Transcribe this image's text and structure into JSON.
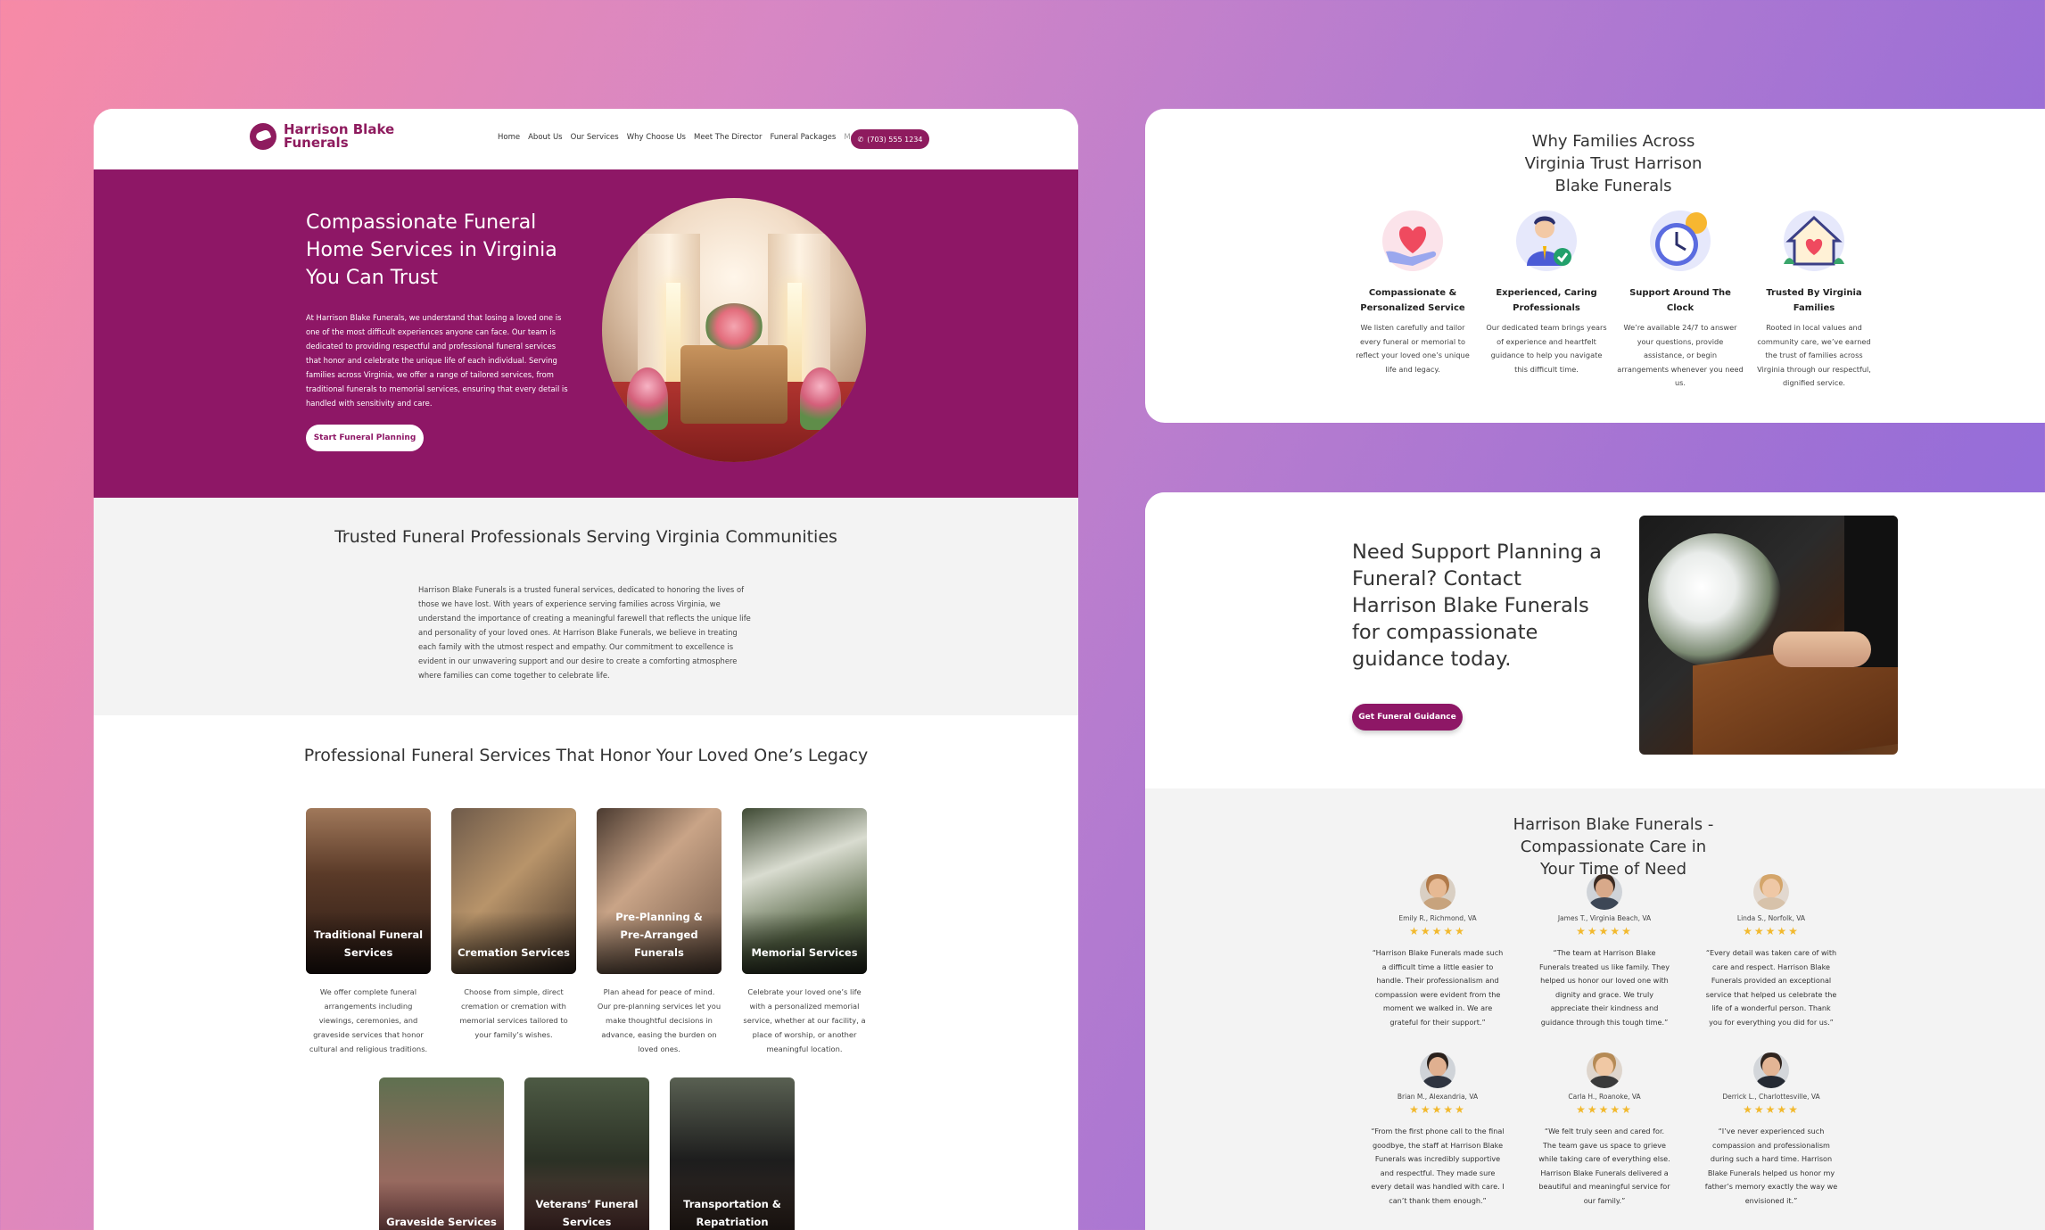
{
  "brand": {
    "name_line1": "Harrison Blake",
    "name_line2": "Funerals",
    "color": "#8e1766"
  },
  "nav": {
    "items": [
      "Home",
      "About Us",
      "Our Services",
      "Why Choose Us",
      "Meet The Director",
      "Funeral Packages"
    ],
    "more": "More",
    "phone": "(703) 555 1234"
  },
  "hero": {
    "title": "Compassionate Funeral Home Services in Virginia You Can Trust",
    "body": "At Harrison Blake Funerals, we understand that losing a loved one is one of the most difficult experiences anyone can face. Our team is dedicated to providing respectful and professional funeral services that honor and celebrate the unique life of each individual. Serving families across Virginia, we offer a range of tailored services, from traditional funerals to memorial services, ensuring that every detail is handled with sensitivity and care.",
    "cta": "Start Funeral Planning"
  },
  "trusted": {
    "title": "Trusted Funeral Professionals Serving Virginia Communities",
    "body": "Harrison Blake Funerals is a trusted funeral services, dedicated to honoring the lives of those we have lost. With years of experience serving families across Virginia, we understand the importance of creating a meaningful farewell that reflects the unique life and personality of your loved ones. At Harrison Blake Funerals, we believe in treating each family with the utmost respect and empathy. Our commitment to excellence is evident in our unwavering support and our desire to create a comforting atmosphere where families can come together to celebrate life."
  },
  "services": {
    "title": "Professional Funeral Services That Honor Your Loved One’s Legacy",
    "items": [
      {
        "title": "Traditional Funeral Services",
        "desc": "We offer complete funeral arrangements including viewings, ceremonies, and graveside services that honor cultural and religious traditions."
      },
      {
        "title": "Cremation Services",
        "desc": "Choose from simple, direct cremation or cremation with memorial services tailored to your family’s wishes."
      },
      {
        "title": "Pre-Planning & Pre-Arranged Funerals",
        "desc": "Plan ahead for peace of mind. Our pre-planning services let you make thoughtful decisions in advance, easing the burden on loved ones."
      },
      {
        "title": "Memorial Services",
        "desc": "Celebrate your loved one’s life with a personalized memorial service, whether at our facility, a place of worship, or another meaningful location."
      },
      {
        "title": "Graveside Services",
        "desc": ""
      },
      {
        "title": "Veterans’ Funeral Services",
        "desc": ""
      },
      {
        "title": "Transportation & Repatriation",
        "desc": ""
      }
    ]
  },
  "why": {
    "title": "Why Families Across Virginia Trust Harrison Blake Funerals",
    "items": [
      {
        "icon": "heart-hand-icon",
        "title": "Compassionate & Personalized Service",
        "desc": "We listen carefully and tailor every funeral or memorial to reflect your loved one’s unique life and legacy."
      },
      {
        "icon": "professional-check-icon",
        "title": "Experienced, Caring Professionals",
        "desc": "Our dedicated team brings years of experience and heartfelt guidance to help you navigate this difficult time."
      },
      {
        "icon": "clock-icon",
        "title": "Support Around The Clock",
        "desc": "We’re available 24/7 to answer your questions, provide assistance, or begin arrangements whenever you need us."
      },
      {
        "icon": "heart-house-icon",
        "title": "Trusted By Virginia Families",
        "desc": "Rooted in local values and community care, we’ve earned the trust of families across Virginia through our respectful, dignified service."
      }
    ]
  },
  "support": {
    "title": "Need Support Planning a Funeral? Contact Harrison Blake Funerals for compassionate guidance today.",
    "cta": "Get Funeral Guidance"
  },
  "testimonials": {
    "title": "Harrison Blake Funerals - Compassionate Care in Your Time of Need",
    "stars": "★★★★★",
    "items": [
      {
        "name": "Emily R., Richmond, VA",
        "quote": "“Harrison Blake Funerals made such a difficult time a little easier to handle. Their professionalism and compassion were evident from the moment we walked in. We are grateful for their support.”"
      },
      {
        "name": "James T., Virginia Beach, VA",
        "quote": "“The team at Harrison Blake Funerals treated us like family. They helped us honor our loved one with dignity and grace. We truly appreciate their kindness and guidance through this tough time.”"
      },
      {
        "name": "Linda S., Norfolk, VA",
        "quote": "“Every detail was taken care of with care and respect. Harrison Blake Funerals provided an exceptional service that helped us celebrate the life of a wonderful person. Thank you for everything you did for us.”"
      },
      {
        "name": "Brian M., Alexandria, VA",
        "quote": "“From the first phone call to the final goodbye, the staff at Harrison Blake Funerals was incredibly supportive and respectful. They made sure every detail was handled with care. I can’t thank them enough.”"
      },
      {
        "name": "Carla H., Roanoke, VA",
        "quote": "“We felt truly seen and cared for. The team gave us space to grieve while taking care of everything else. Harrison Blake Funerals delivered a beautiful and meaningful service for our family.”"
      },
      {
        "name": "Derrick L., Charlottesville, VA",
        "quote": "“I’ve never experienced such compassion and professionalism during such a hard time. Harrison Blake Funerals helped us honor my father’s memory exactly the way we envisioned it.”"
      }
    ]
  }
}
